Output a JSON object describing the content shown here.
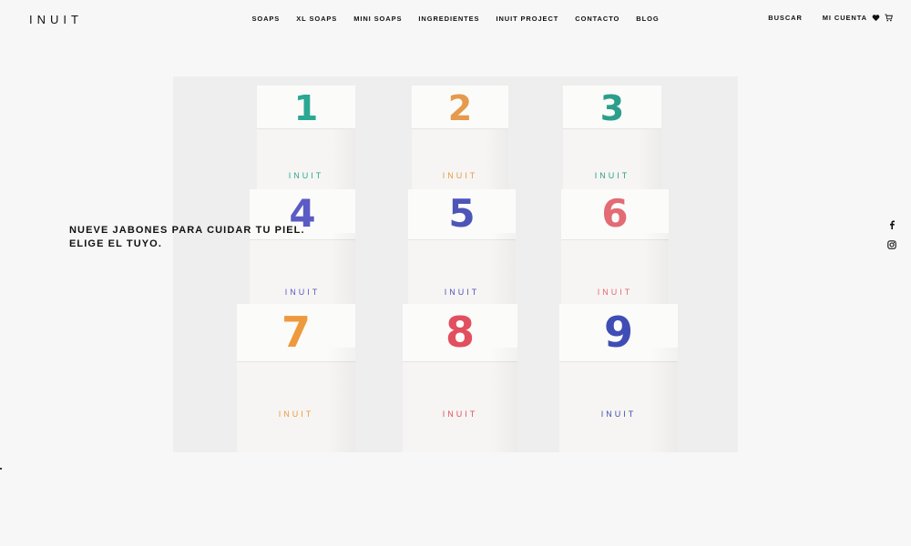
{
  "header": {
    "logo": "INUIT",
    "nav": [
      "SOAPS",
      "XL SOAPS",
      "MINI SOAPS",
      "INGREDIENTES",
      "INUIT PROJECT",
      "CONTACTO",
      "BLOG"
    ],
    "search_label": "BUSCAR",
    "account_label": "MI CUENTA"
  },
  "hero": {
    "line1": "NUEVE JABONES PARA CUIDAR TU PIEL.",
    "line2": "ELIGE EL TUYO.",
    "boxes": [
      {
        "number": "1",
        "color": "#2aa893"
      },
      {
        "number": "2",
        "color": "#e59a4c"
      },
      {
        "number": "3",
        "color": "#2a9f8b"
      },
      {
        "number": "4",
        "color": "#5a5bc4"
      },
      {
        "number": "5",
        "color": "#4d55b8"
      },
      {
        "number": "6",
        "color": "#e26b74"
      },
      {
        "number": "7",
        "color": "#ee9a3c"
      },
      {
        "number": "8",
        "color": "#e24f5e"
      },
      {
        "number": "9",
        "color": "#3f4db5"
      }
    ],
    "box_brand": "INUIT"
  },
  "social": {
    "icons": [
      "facebook-icon",
      "instagram-icon"
    ]
  }
}
